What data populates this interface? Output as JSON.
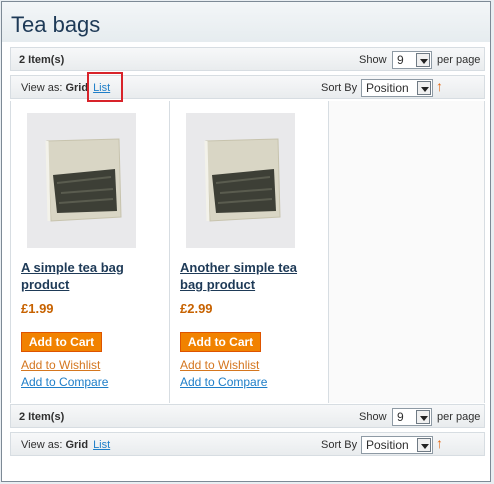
{
  "category": {
    "title": "Tea bags"
  },
  "toolbar": {
    "items_count": "2 Item(s)",
    "show_label": "Show",
    "limit_value": "9",
    "per_page_label": "per page",
    "view_as_label": "View as:",
    "view_grid": "Grid",
    "view_list": "List",
    "sort_label": "Sort By",
    "sort_value": "Position",
    "sort_direction": "↑"
  },
  "products": [
    {
      "name": "A simple tea bag product",
      "price": "£1.99",
      "add_to_cart": "Add to Cart",
      "wishlist": "Add to Wishlist",
      "compare": "Add to Compare"
    },
    {
      "name": "Another simple tea bag product",
      "price": "£2.99",
      "add_to_cart": "Add to Cart",
      "wishlist": "Add to Wishlist",
      "compare": "Add to Compare"
    }
  ],
  "colors": {
    "accent_orange": "#f18200",
    "link_blue": "#1e7ec8",
    "price": "#c76200",
    "highlight": "#d8232a"
  }
}
